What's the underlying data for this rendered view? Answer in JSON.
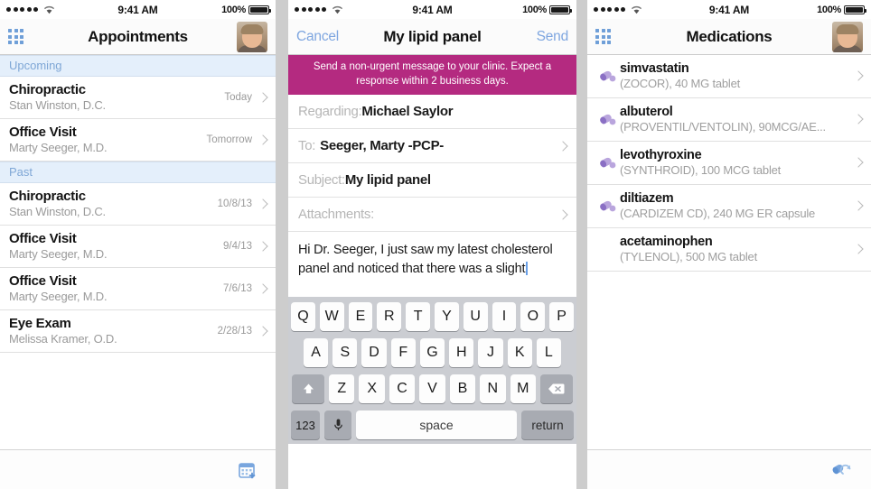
{
  "status_bar": {
    "signal_dots": 5,
    "wifi_icon": "wifi-icon",
    "time": "9:41 AM",
    "battery_pct": "100%"
  },
  "appointments": {
    "nav": {
      "grid_icon": "grid-menu-icon",
      "title": "Appointments",
      "avatar": "user-avatar"
    },
    "sections": [
      {
        "label": "Upcoming",
        "rows": [
          {
            "title": "Chiropractic",
            "sub": "Stan Winston, D.C.",
            "meta": "Today"
          },
          {
            "title": "Office Visit",
            "sub": "Marty Seeger, M.D.",
            "meta": "Tomorrow"
          }
        ]
      },
      {
        "label": "Past",
        "rows": [
          {
            "title": "Chiropractic",
            "sub": "Stan Winston, D.C.",
            "meta": "10/8/13"
          },
          {
            "title": "Office Visit",
            "sub": "Marty Seeger, M.D.",
            "meta": "9/4/13"
          },
          {
            "title": "Office Visit",
            "sub": "Marty Seeger, M.D.",
            "meta": "7/6/13"
          },
          {
            "title": "Eye Exam",
            "sub": "Melissa Kramer, O.D.",
            "meta": "2/28/13"
          }
        ]
      }
    ],
    "toolbar": {
      "icon": "add-appointment-calendar-icon"
    }
  },
  "compose": {
    "nav": {
      "cancel_label": "Cancel",
      "title": "My lipid panel",
      "send_label": "Send"
    },
    "banner": "Send a non-urgent message to your clinic. Expect a response within 2 business days.",
    "banner_color": "#b42a80",
    "fields": [
      {
        "label": "Regarding:",
        "value": "Michael Saylor",
        "chevron": false
      },
      {
        "label": "To:",
        "value": "Seeger, Marty -PCP-",
        "chevron": true
      },
      {
        "label": "Subject:",
        "value": "My lipid panel",
        "chevron": false
      },
      {
        "label": "Attachments:",
        "value": "",
        "chevron": true
      }
    ],
    "body": "Hi Dr. Seeger, I just saw my latest cholesterol panel and noticed that there was a slight",
    "keyboard": {
      "row1": [
        "Q",
        "W",
        "E",
        "R",
        "T",
        "Y",
        "U",
        "I",
        "O",
        "P"
      ],
      "row2": [
        "A",
        "S",
        "D",
        "F",
        "G",
        "H",
        "J",
        "K",
        "L"
      ],
      "row3": [
        "Z",
        "X",
        "C",
        "V",
        "B",
        "N",
        "M"
      ],
      "shift_icon": "shift-arrow-icon",
      "delete_icon": "backspace-delete-icon",
      "num_label": "123",
      "mic_icon": "microphone-icon",
      "space_label": "space",
      "return_label": "return"
    }
  },
  "medications": {
    "nav": {
      "grid_icon": "grid-menu-icon",
      "title": "Medications",
      "avatar": "user-avatar"
    },
    "rows": [
      {
        "name": "simvastatin",
        "desc": "(ZOCOR), 40 MG tablet",
        "pill": true
      },
      {
        "name": "albuterol",
        "desc": "(PROVENTIL/VENTOLIN), 90MCG/AE...",
        "pill": true
      },
      {
        "name": "levothyroxine",
        "desc": "(SYNTHROID), 100 MCG tablet",
        "pill": true
      },
      {
        "name": "diltiazem",
        "desc": "(CARDIZEM CD), 240 MG ER capsule",
        "pill": true
      },
      {
        "name": "acetaminophen",
        "desc": "(TYLENOL), 500 MG tablet",
        "pill": false
      }
    ],
    "toolbar": {
      "icon": "refill-medication-icon"
    }
  }
}
